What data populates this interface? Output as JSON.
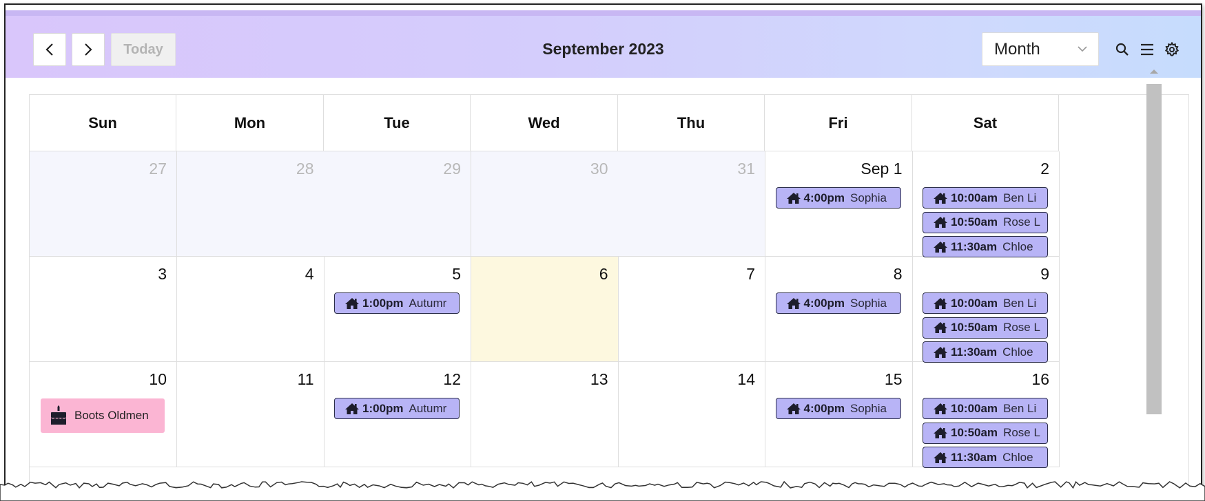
{
  "header": {
    "prev_label": "<",
    "next_label": ">",
    "today_label": "Today",
    "title": "September 2023",
    "view_select_value": "Month",
    "icons": [
      "chevron-left-icon",
      "chevron-right-icon",
      "search-icon",
      "menu-icon",
      "gear-icon"
    ]
  },
  "weekdays": [
    "Sun",
    "Mon",
    "Tue",
    "Wed",
    "Thu",
    "Fri",
    "Sat"
  ],
  "weeks": [
    {
      "days": [
        {
          "num": "27",
          "other": true
        },
        {
          "num": "28",
          "other": true
        },
        {
          "num": "29",
          "other": true
        },
        {
          "num": "30",
          "other": true
        },
        {
          "num": "31",
          "other": true
        },
        {
          "num": "Sep 1",
          "events": [
            {
              "time": "4:00pm",
              "name": "Sophia"
            }
          ]
        },
        {
          "num": "2",
          "events": [
            {
              "time": "10:00am",
              "name": "Ben Li"
            },
            {
              "time": "10:50am",
              "name": "Rose L"
            },
            {
              "time": "11:30am",
              "name": "Chloe"
            }
          ]
        }
      ]
    },
    {
      "days": [
        {
          "num": "3"
        },
        {
          "num": "4"
        },
        {
          "num": "5",
          "events": [
            {
              "time": "1:00pm",
              "name": "Autumr"
            }
          ]
        },
        {
          "num": "6",
          "today": true
        },
        {
          "num": "7"
        },
        {
          "num": "8",
          "events": [
            {
              "time": "4:00pm",
              "name": "Sophia"
            }
          ]
        },
        {
          "num": "9",
          "events": [
            {
              "time": "10:00am",
              "name": "Ben Li"
            },
            {
              "time": "10:50am",
              "name": "Rose L"
            },
            {
              "time": "11:30am",
              "name": "Chloe"
            }
          ]
        }
      ]
    },
    {
      "days": [
        {
          "num": "10",
          "birthday": "Boots Oldmen"
        },
        {
          "num": "11"
        },
        {
          "num": "12",
          "events": [
            {
              "time": "1:00pm",
              "name": "Autumr"
            }
          ]
        },
        {
          "num": "13"
        },
        {
          "num": "14"
        },
        {
          "num": "15",
          "events": [
            {
              "time": "4:00pm",
              "name": "Sophia"
            }
          ]
        },
        {
          "num": "16",
          "events": [
            {
              "time": "10:00am",
              "name": "Ben Li"
            },
            {
              "time": "10:50am",
              "name": "Rose L"
            },
            {
              "time": "11:30am",
              "name": "Chloe"
            }
          ]
        }
      ]
    }
  ],
  "colors": {
    "event_bg": "#b8b4f6",
    "event_border": "#2b2d49",
    "birthday_bg": "#fbb5d3",
    "today_bg": "#fdf8df",
    "other_month_bg": "#f5f6fd"
  }
}
